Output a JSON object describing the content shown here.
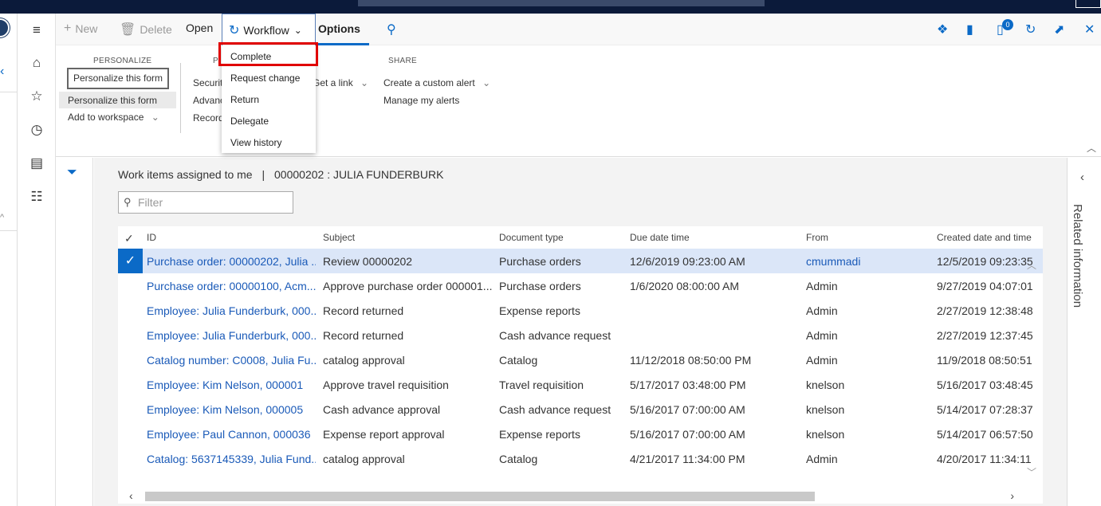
{
  "action_pane": {
    "new_label": "New",
    "delete_label": "Delete",
    "open_label": "Open",
    "workflow_label": "Workflow",
    "options_label": "Options",
    "notification_count": "0"
  },
  "workflow_menu": {
    "items": [
      "Complete",
      "Request change",
      "Return",
      "Delegate",
      "View history"
    ],
    "highlighted": "Complete"
  },
  "ribbon": {
    "personalize_header": "PERSONALIZE",
    "personalize_button": "Personalize this form",
    "personalize_link": "Personalize this form",
    "add_to_workspace": "Add to workspace",
    "page_options_header_partial": "P",
    "page_options_items_partial": [
      "Securit",
      "Advanc",
      "Record"
    ],
    "get_a_link": "Get a link",
    "share_header": "SHARE",
    "create_alert": "Create a custom alert",
    "manage_alerts": "Manage my alerts"
  },
  "breadcrumb": {
    "parent": "Work items assigned to me",
    "separator": "|",
    "current": "00000202 : JULIA FUNDERBURK"
  },
  "filter": {
    "placeholder": "Filter"
  },
  "grid": {
    "columns": [
      "ID",
      "Subject",
      "Document type",
      "Due date time",
      "From",
      "Created date and time"
    ],
    "rows": [
      {
        "id": "Purchase order: 00000202, Julia ...",
        "subject": "Review 00000202",
        "doctype": "Purchase orders",
        "due": "12/6/2019 09:23:00 AM",
        "from": "cmummadi",
        "created": "12/5/2019 09:23:35",
        "selected": true,
        "from_link": true
      },
      {
        "id": "Purchase order: 00000100, Acm...",
        "subject": "Approve purchase order 000001...",
        "doctype": "Purchase orders",
        "due": "1/6/2020 08:00:00 AM",
        "from": "Admin",
        "created": "9/27/2019 04:07:01"
      },
      {
        "id": "Employee: Julia Funderburk, 000...",
        "subject": "Record returned",
        "doctype": "Expense reports",
        "due": "",
        "from": "Admin",
        "created": "2/27/2019 12:38:48"
      },
      {
        "id": "Employee: Julia Funderburk, 000...",
        "subject": "Record returned",
        "doctype": "Cash advance request",
        "due": "",
        "from": "Admin",
        "created": "2/27/2019 12:37:45"
      },
      {
        "id": "Catalog number: C0008, Julia Fu...",
        "subject": "catalog approval",
        "doctype": "Catalog",
        "due": "11/12/2018 08:50:00 PM",
        "from": "Admin",
        "created": "11/9/2018 08:50:51"
      },
      {
        "id": "Employee: Kim Nelson, 000001",
        "subject": "Approve travel requisition",
        "doctype": "Travel requisition",
        "due": "5/17/2017 03:48:00 PM",
        "from": "knelson",
        "created": "5/16/2017 03:48:45"
      },
      {
        "id": "Employee: Kim Nelson, 000005",
        "subject": "Cash advance approval",
        "doctype": "Cash advance request",
        "due": "5/16/2017 07:00:00 AM",
        "from": "knelson",
        "created": "5/14/2017 07:28:37"
      },
      {
        "id": "Employee: Paul Cannon, 000036",
        "subject": "Expense report approval",
        "doctype": "Expense reports",
        "due": "5/16/2017 07:00:00 AM",
        "from": "knelson",
        "created": "5/14/2017 06:57:50"
      },
      {
        "id": "Catalog: 5637145339, Julia Fund...",
        "subject": "catalog approval",
        "doctype": "Catalog",
        "due": "4/21/2017 11:34:00 PM",
        "from": "Admin",
        "created": "4/20/2017 11:34:11"
      }
    ]
  },
  "related_panel": {
    "label": "Related information"
  },
  "colors": {
    "accent": "#0b6ac7",
    "link": "#1a5ab8",
    "selected_row": "#dbe6f8",
    "highlight_box": "#e00000",
    "topbar": "#0b1a3a"
  }
}
